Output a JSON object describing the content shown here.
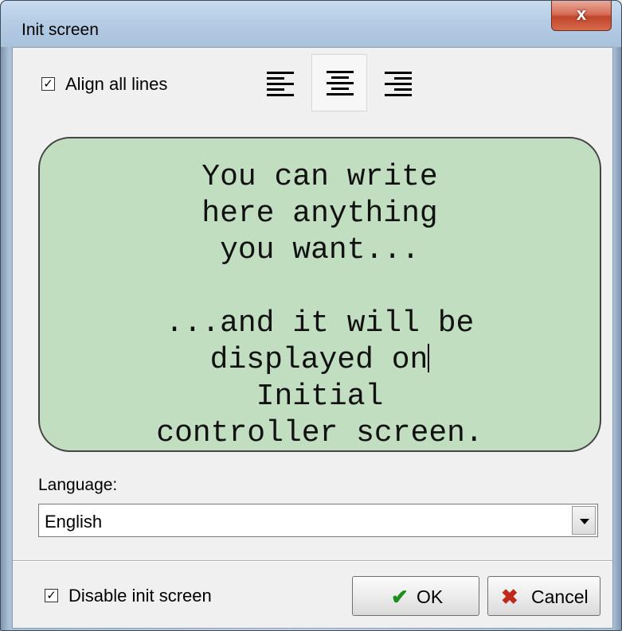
{
  "window": {
    "title": "Init screen",
    "close_glyph": "x"
  },
  "options": {
    "align_all_lines_label": "Align all lines",
    "align_all_lines_checked": true,
    "alignment_buttons": [
      {
        "name": "align-left",
        "icon": "align-left-icon"
      },
      {
        "name": "align-center",
        "icon": "align-center-icon",
        "active": true
      },
      {
        "name": "align-right",
        "icon": "align-right-icon"
      }
    ]
  },
  "lcd": {
    "background": "#c1dec1",
    "lines": [
      "You can write",
      "here anything",
      "you want...",
      "",
      "...and it will be",
      "displayed on",
      "Initial",
      "controller screen."
    ]
  },
  "language": {
    "label": "Language:",
    "value": "English"
  },
  "footer": {
    "disable_label": "Disable init screen",
    "disable_checked": true,
    "ok_label": "OK",
    "cancel_label": "Cancel",
    "ok_icon": "check-icon",
    "cancel_icon": "x-icon",
    "ok_icon_color": "#1a8f1a",
    "cancel_icon_color": "#c0281c"
  }
}
